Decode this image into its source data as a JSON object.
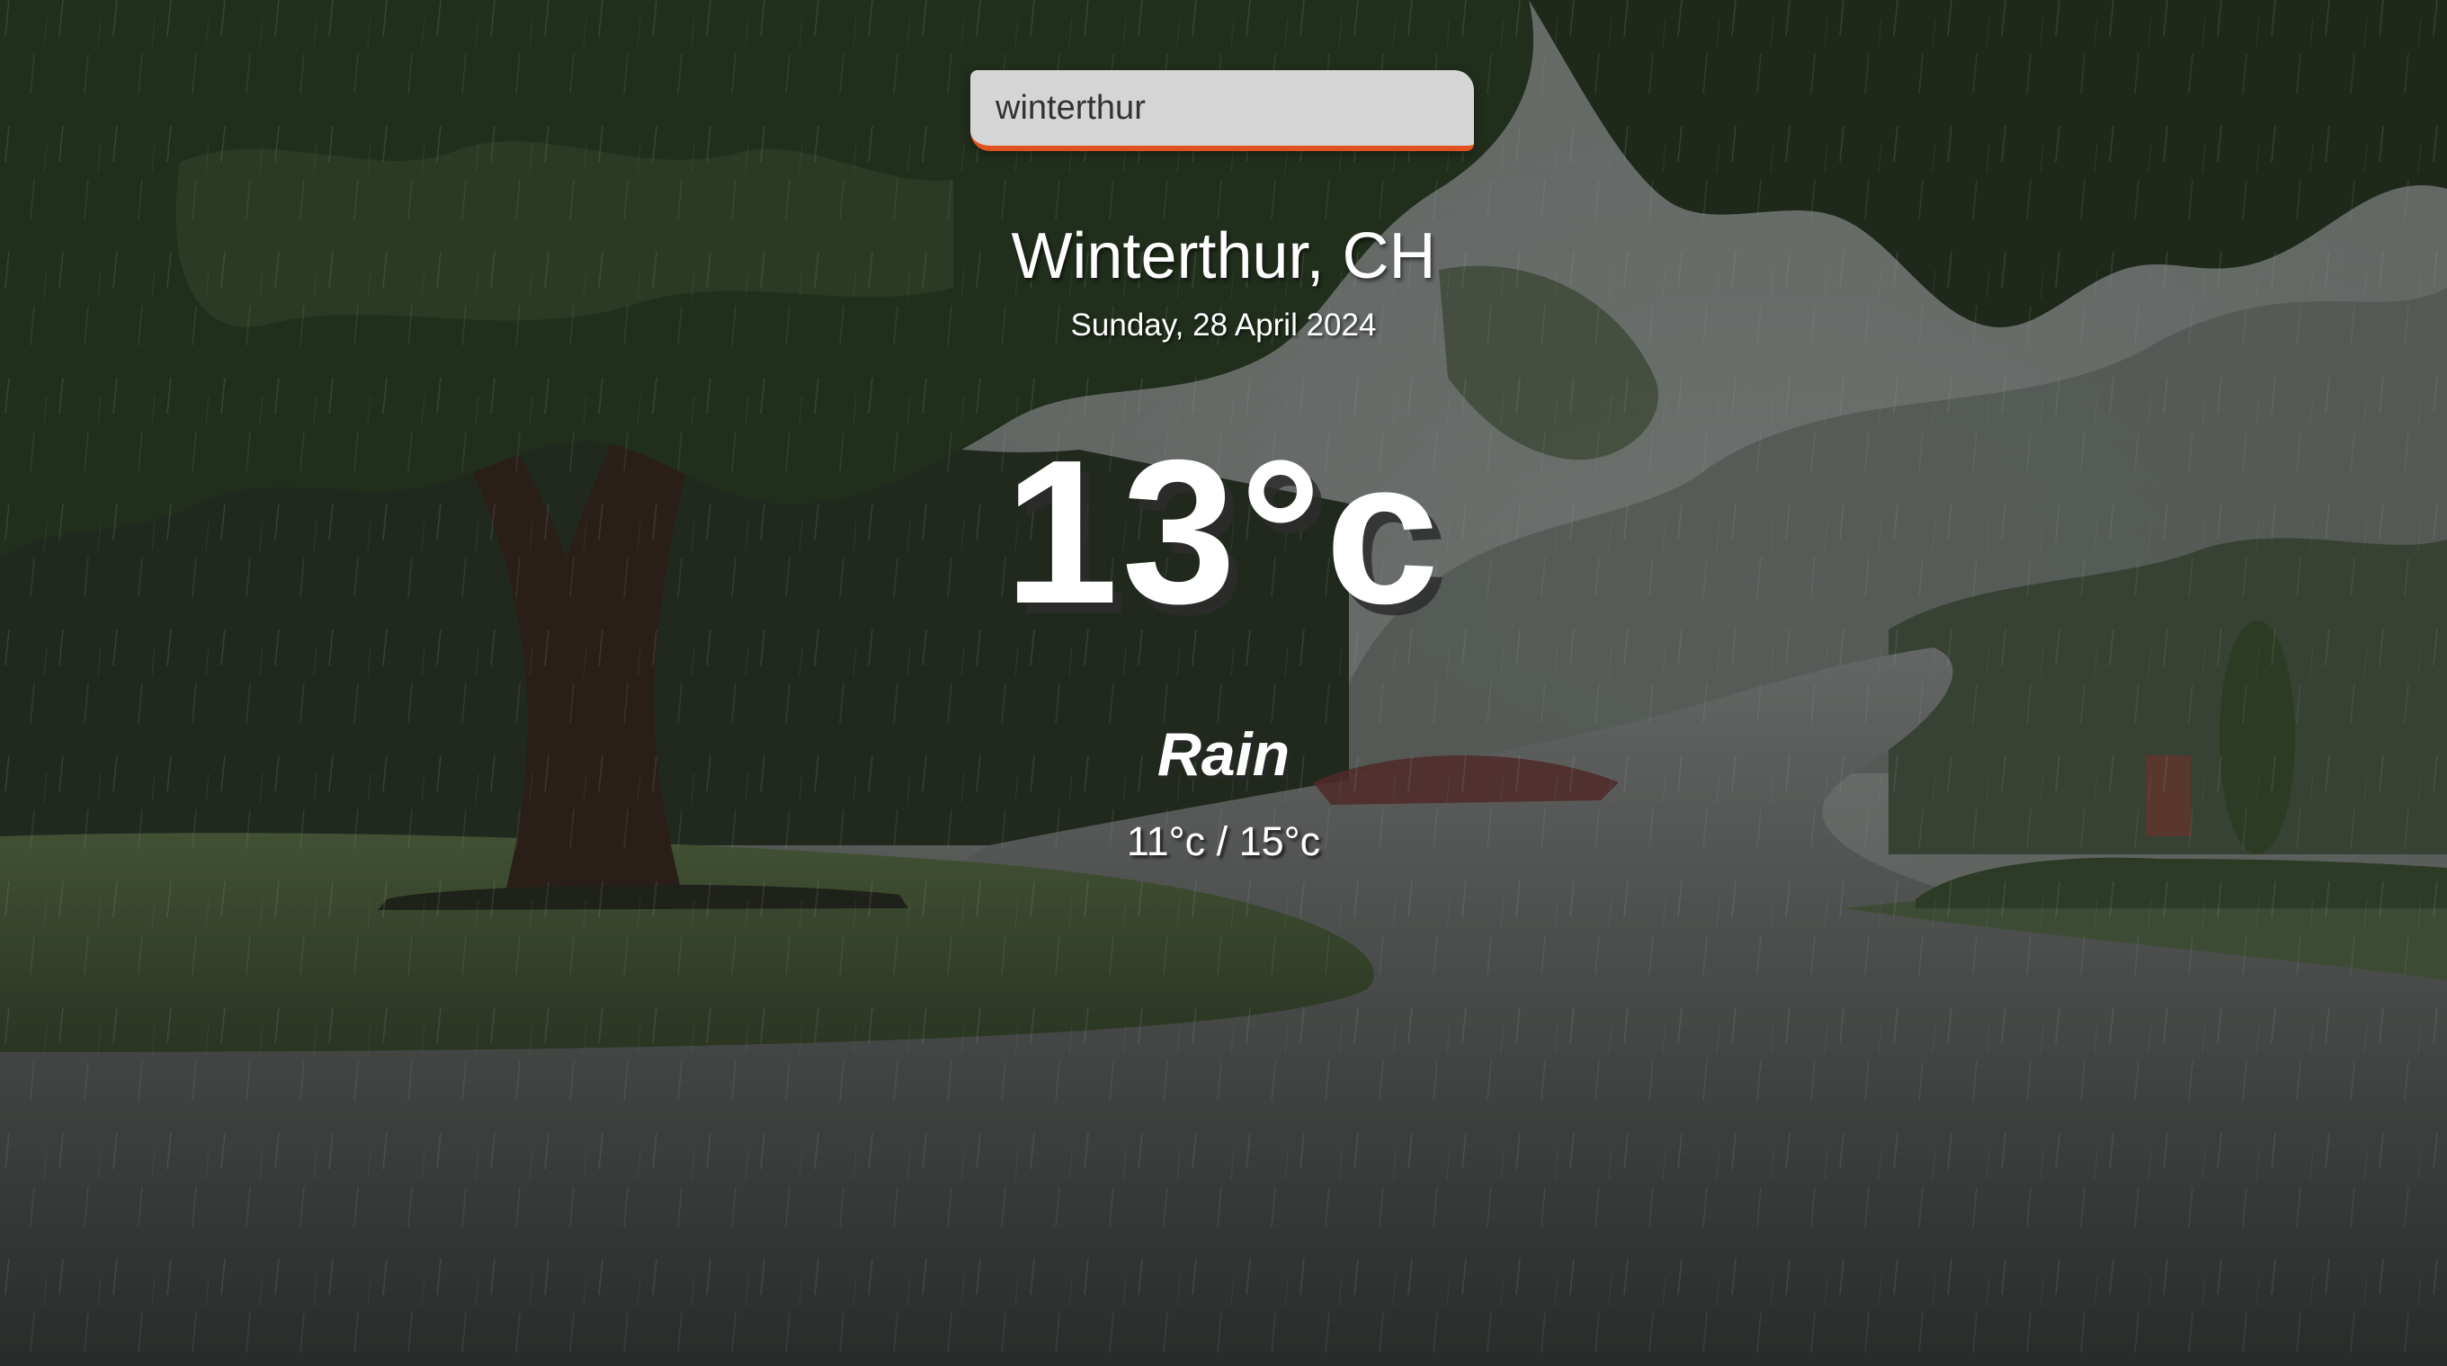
{
  "search": {
    "value": "winterthur",
    "underline_color": "#e2521e"
  },
  "location": {
    "name": "Winterthur, CH",
    "date": "Sunday, 28 April 2024"
  },
  "weather": {
    "temperature": "13°c",
    "condition": "Rain",
    "min_max": "11°c / 15°c"
  }
}
